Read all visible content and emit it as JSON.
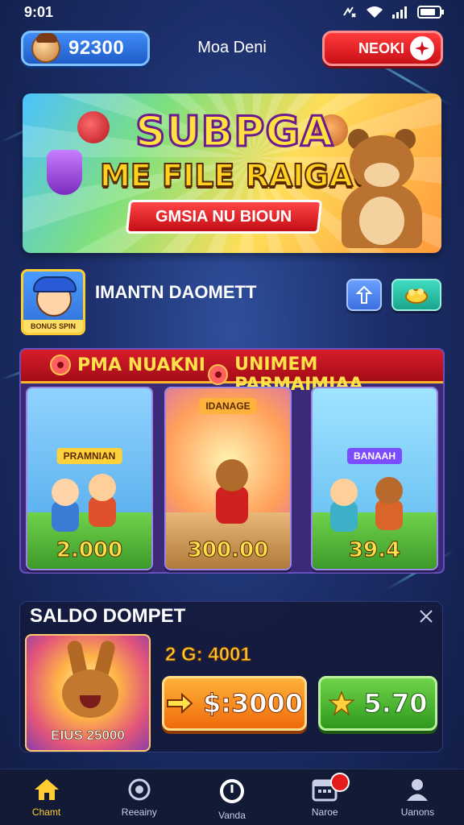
{
  "status_bar": {
    "time": "9:01"
  },
  "header": {
    "coin_balance": "92300",
    "title": "Moa Deni",
    "action_label": "NEOKI"
  },
  "banner": {
    "logo": "SUBPGA",
    "headline": "ME FILE RAIGAOI",
    "ribbon": "GMSIA NU BIOUN"
  },
  "profile": {
    "thumb_label": "BONUS SPIN",
    "name": "IMANTN DAOMETT",
    "upload_icon": "upload-icon",
    "treasure_icon": "treasure-icon"
  },
  "categories": {
    "tabs": [
      "PMA NUAKNI",
      "UNIMEM PARMAIMIAA"
    ],
    "cards": [
      {
        "tag": "PRAMNIAN",
        "value": "2.000"
      },
      {
        "tag": "IDANAGE",
        "value": "300.00"
      },
      {
        "tag": "BANAAH",
        "value": "39.4"
      }
    ]
  },
  "saldo": {
    "title": "SALDO DOMPET",
    "art_label": "EIUS 25000",
    "amount": "2 G: 4001",
    "primary_button": "$:3000",
    "secondary_button": "5.70"
  },
  "nav": {
    "items": [
      {
        "label": "Chamt",
        "icon": "home-icon"
      },
      {
        "label": "Reeainy",
        "icon": "target-icon"
      },
      {
        "label": "Vanda",
        "icon": "clock-icon"
      },
      {
        "label": "Naroe",
        "icon": "calendar-icon"
      },
      {
        "label": "Uanons",
        "icon": "user-icon"
      }
    ]
  },
  "colors": {
    "accent_yellow": "#ffcc33",
    "brand_red": "#d81c2a",
    "primary_blue": "#3f8cf7",
    "success_green": "#2f9a1e",
    "cta_orange": "#f06a0a"
  }
}
